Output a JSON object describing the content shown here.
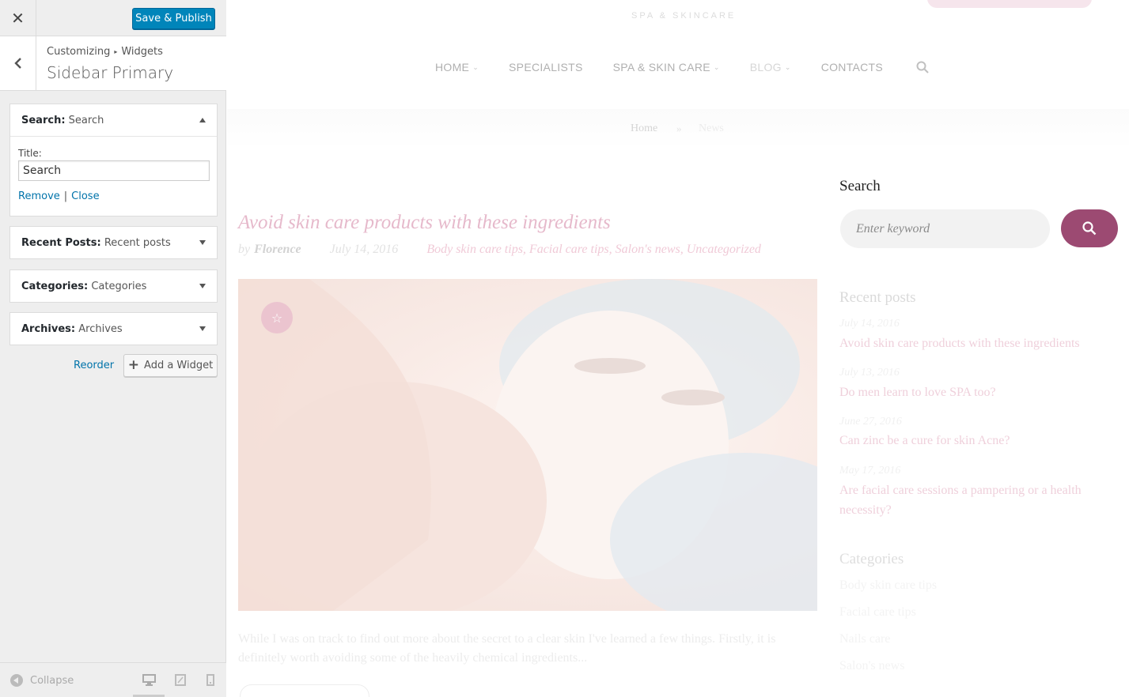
{
  "customizer": {
    "publish_label": "Save & Publish",
    "breadcrumb": {
      "root": "Customizing",
      "current": "Widgets"
    },
    "panel_title": "Sidebar Primary",
    "widgets": [
      {
        "type": "Search",
        "title": "Search",
        "expanded": true
      },
      {
        "type": "Recent Posts",
        "title": "Recent posts",
        "expanded": false
      },
      {
        "type": "Categories",
        "title": "Categories",
        "expanded": false
      },
      {
        "type": "Archives",
        "title": "Archives",
        "expanded": false
      }
    ],
    "search_form": {
      "title_label": "Title:",
      "title_value": "Search",
      "remove_label": "Remove",
      "separator": "|",
      "close_label": "Close"
    },
    "reorder_label": "Reorder",
    "add_widget_label": "Add a Widget",
    "footer": {
      "collapse_label": "Collapse"
    }
  },
  "site": {
    "logo_subtitle": "SPA & SKINCARE",
    "nav": [
      "HOME",
      "SPECIALISTS",
      "SPA & SKIN CARE",
      "BLOG",
      "CONTACTS"
    ],
    "breadcrumb": {
      "home": "Home",
      "separator": "»",
      "current": "News"
    },
    "post": {
      "title": "Avoid skin care products with these ingredients",
      "by": "by",
      "author": "Florence",
      "date": "July 14, 2016",
      "categories": "Body skin care tips, Facial care tips, Salon's news, Uncategorized",
      "excerpt": "While I was on track to find out more about the secret to a clear skin I've learned a few things. Firstly, it is definitely worth avoiding some of the heavily chemical ingredients..."
    },
    "sidebar": {
      "search_title": "Search",
      "search_placeholder": "Enter keyword",
      "recent_title": "Recent posts",
      "recent_posts": [
        {
          "date": "July 14, 2016",
          "title": "Avoid skin care products with these ingredients"
        },
        {
          "date": "July 13, 2016",
          "title": "Do men learn to love SPA too?"
        },
        {
          "date": "June 27, 2016",
          "title": "Can zinc be a cure for skin Acne?"
        },
        {
          "date": "May 17, 2016",
          "title": "Are facial care sessions a pampering or a health necessity?"
        }
      ],
      "categories_title": "Categories",
      "categories": [
        "Body skin care tips",
        "Facial care tips",
        "Nails care",
        "Salon's news"
      ]
    }
  },
  "colors": {
    "publish": "#0085ba",
    "link": "#0073aa",
    "accent": "#9c4a72"
  },
  "icons": {
    "close": "close-icon",
    "back": "back-arrow-icon",
    "search": "search-icon",
    "star": "star-icon"
  }
}
